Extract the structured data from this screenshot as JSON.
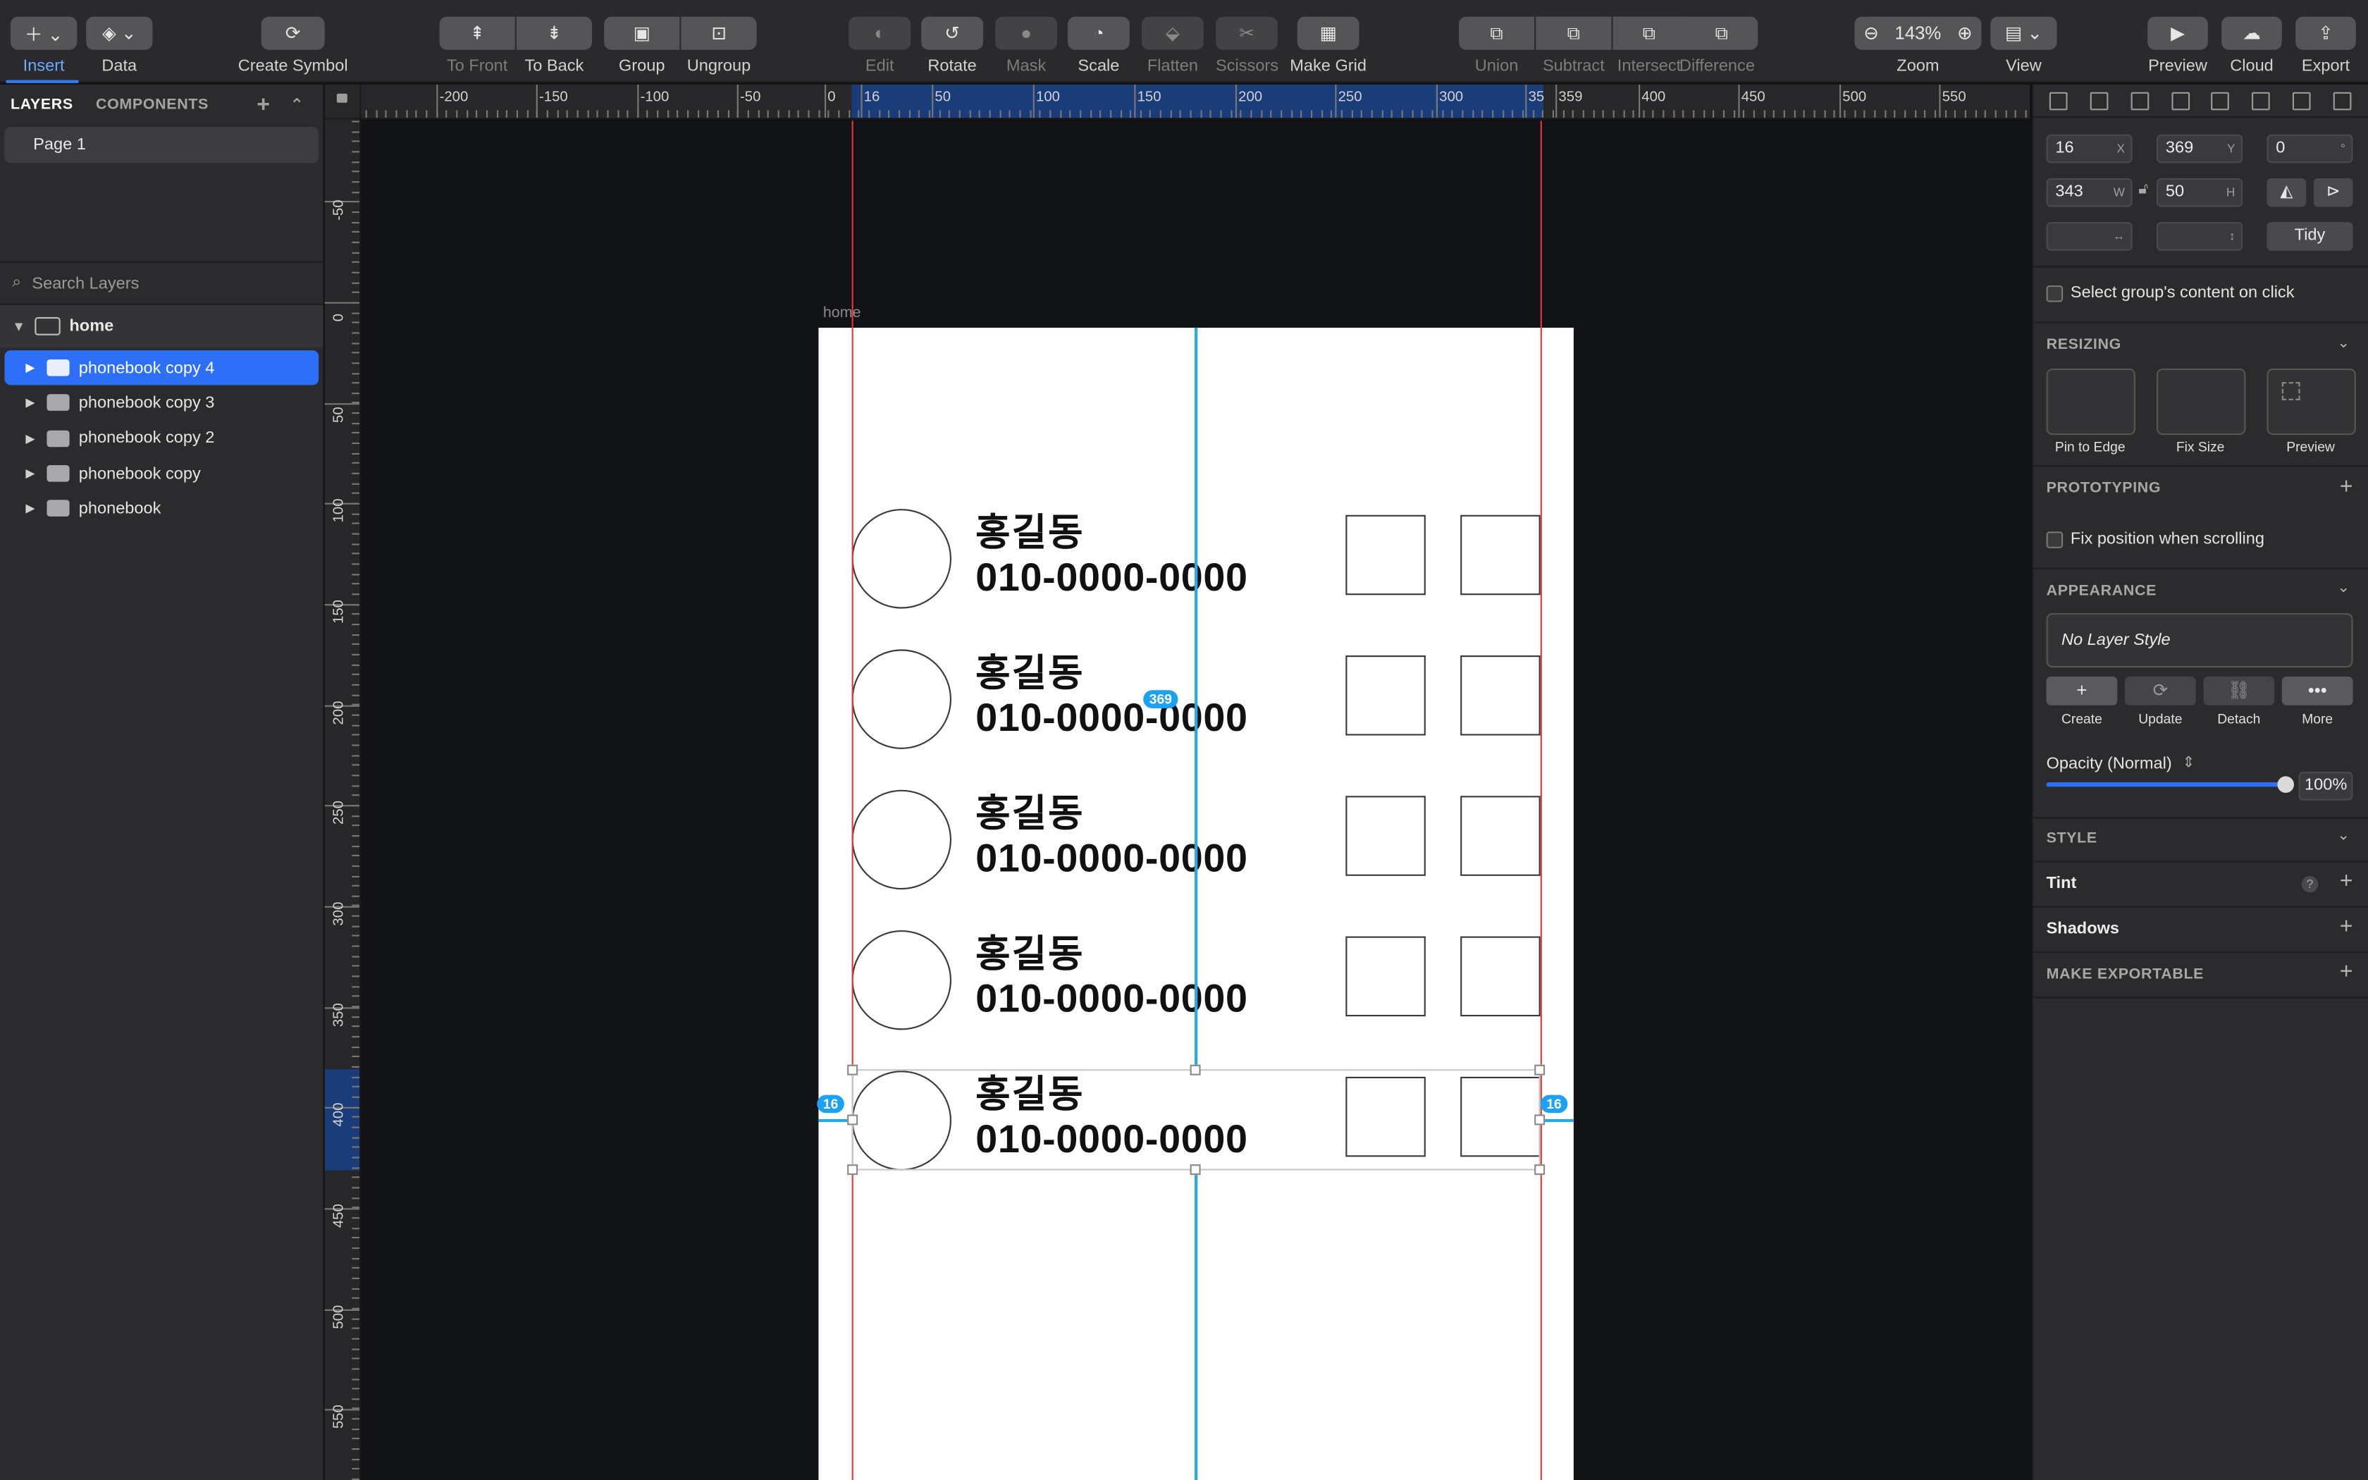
{
  "toolbar": {
    "insert": "Insert",
    "data": "Data",
    "create_symbol": "Create Symbol",
    "to_front": "To Front",
    "to_back": "To Back",
    "group": "Group",
    "ungroup": "Ungroup",
    "edit": "Edit",
    "rotate": "Rotate",
    "mask": "Mask",
    "scale": "Scale",
    "flatten": "Flatten",
    "scissors": "Scissors",
    "make_grid": "Make Grid",
    "union": "Union",
    "subtract": "Subtract",
    "intersect": "Intersect",
    "difference": "Difference",
    "zoom_value": "143%",
    "zoom_label": "Zoom",
    "view": "View",
    "preview": "Preview",
    "cloud": "Cloud",
    "export": "Export"
  },
  "left_panel": {
    "tab_layers": "LAYERS",
    "tab_components": "COMPONENTS",
    "page": "Page 1",
    "search_placeholder": "Search Layers",
    "artboard": "home",
    "layers": [
      {
        "name": "phonebook copy 4",
        "selected": true
      },
      {
        "name": "phonebook copy 3",
        "selected": false
      },
      {
        "name": "phonebook copy 2",
        "selected": false
      },
      {
        "name": "phonebook copy",
        "selected": false
      },
      {
        "name": "phonebook",
        "selected": false
      }
    ]
  },
  "rulers": {
    "h_labels": [
      "-200",
      "-150",
      "-100",
      "-50",
      "0",
      "16",
      "50",
      "100",
      "150",
      "200",
      "250",
      "300",
      "35",
      "359",
      "400",
      "450",
      "500",
      "550"
    ],
    "v_labels": [
      "-50",
      "0",
      "50",
      "100",
      "150",
      "200",
      "250",
      "300",
      "350",
      "400",
      "450",
      "500",
      "550"
    ]
  },
  "canvas": {
    "artboard_label": "home",
    "rows": [
      {
        "name": "홍길동",
        "phone": "010-0000-0000"
      },
      {
        "name": "홍길동",
        "phone": "010-0000-0000"
      },
      {
        "name": "홍길동",
        "phone": "010-0000-0000"
      },
      {
        "name": "홍길동",
        "phone": "010-0000-0000"
      },
      {
        "name": "홍길동",
        "phone": "010-0000-0000"
      }
    ],
    "badge_y": "369",
    "badge_left": "16",
    "badge_right": "16"
  },
  "inspector": {
    "x": "16",
    "x_suffix": "X",
    "y": "369",
    "y_suffix": "Y",
    "rotation": "0",
    "rotation_suffix": "°",
    "w": "343",
    "w_suffix": "W",
    "h": "50",
    "h_suffix": "H",
    "tidy": "Tidy",
    "select_group_content": "Select group's content on click",
    "resizing": "RESIZING",
    "pin_to_edge": "Pin to Edge",
    "fix_size": "Fix Size",
    "preview": "Preview",
    "prototyping": "PROTOTYPING",
    "fix_position": "Fix position when scrolling",
    "appearance": "APPEARANCE",
    "layer_style": "No Layer Style",
    "create": "Create",
    "update": "Update",
    "detach": "Detach",
    "more": "More",
    "opacity_label": "Opacity (Normal)",
    "opacity_value": "100%",
    "opacity_fraction": 1.0,
    "style": "STYLE",
    "tint": "Tint",
    "shadows": "Shadows",
    "make_exportable": "MAKE EXPORTABLE"
  }
}
